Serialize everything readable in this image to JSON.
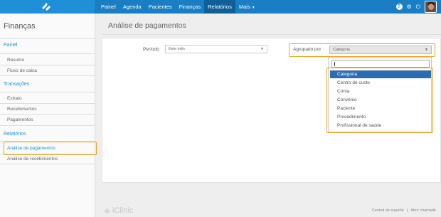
{
  "nav": {
    "items": [
      "Painel",
      "Agenda",
      "Pacientes",
      "Finanças",
      "Relatórios",
      "Mais"
    ],
    "active": "Relatórios"
  },
  "topbar": {
    "help_icon": "?",
    "settings_icon": "gear-icon"
  },
  "sidebar": {
    "title": "Finanças",
    "sections": [
      {
        "label": "Painel",
        "items": [
          "Resumo",
          "Fluxo de caixa"
        ]
      },
      {
        "label": "Transações",
        "items": [
          "Extrato",
          "Recebimentos",
          "Pagamentos"
        ]
      },
      {
        "label": "Relatórios",
        "items": [
          "Análise de pagamentos",
          "Análise de recebimentos"
        ]
      }
    ],
    "active_item": "Análise de pagamentos"
  },
  "main": {
    "title": "Análise de pagamentos",
    "period": {
      "label": "Período",
      "value": "Este mês"
    },
    "group": {
      "label": "Agrupado por",
      "value": "Categoria"
    },
    "dropdown": {
      "search_value": "",
      "options": [
        "Categoria",
        "Centro de custo",
        "Conta",
        "Convênio",
        "Paciente",
        "Procedimento",
        "Profissional de saúde"
      ],
      "selected": "Categoria"
    }
  },
  "footer": {
    "logo": "iClinic",
    "links": [
      "Central de suporte",
      "Abrir chamado"
    ],
    "separator": "|"
  },
  "colors": {
    "brand": "#1a7ec5",
    "highlight": "#f0a31c",
    "selected_option": "#2c6cb3"
  }
}
